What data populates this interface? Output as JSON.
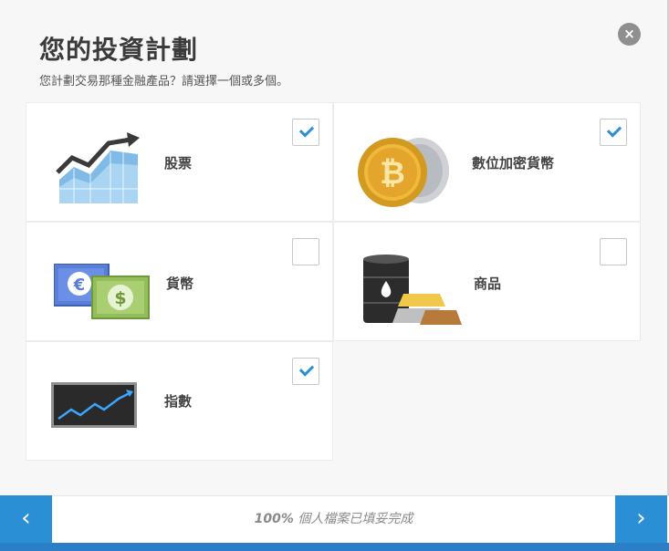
{
  "header": {
    "title": "您的投資計劃",
    "subtitle": "您計劃交易那種金融產品？請選擇一個或多個。",
    "close_label": "×"
  },
  "products": [
    {
      "label": "股票",
      "checked": true,
      "icon": "stock-chart-icon"
    },
    {
      "label": "數位加密貨幣",
      "checked": true,
      "icon": "bitcoin-icon"
    },
    {
      "label": "貨幣",
      "checked": false,
      "icon": "currency-notes-icon"
    },
    {
      "label": "商品",
      "checked": false,
      "icon": "commodities-icon"
    },
    {
      "label": "指數",
      "checked": true,
      "icon": "index-chart-icon"
    }
  ],
  "footer": {
    "prev_label": "‹",
    "next_label": "›",
    "progress_percent_text": "100%",
    "progress_text": " 個人檔案已填妥完成",
    "progress_fraction": 1.0
  },
  "colors": {
    "accent": "#2a8fd4",
    "title": "#3b3b3b"
  }
}
